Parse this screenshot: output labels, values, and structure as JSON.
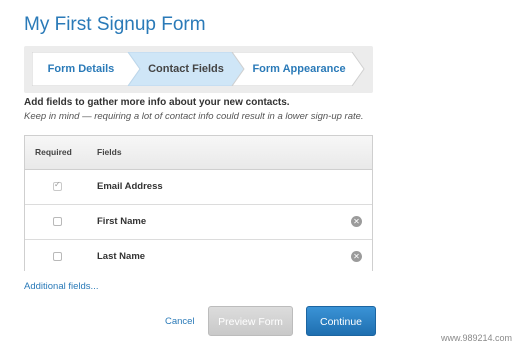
{
  "page": {
    "title": "My First Signup Form"
  },
  "steps": [
    {
      "label": "Form Details",
      "active": false
    },
    {
      "label": "Contact Fields",
      "active": true
    },
    {
      "label": "Form Appearance",
      "active": false
    }
  ],
  "intro": "Add fields to gather more info about your new contacts.",
  "note": "Keep in mind — requiring a lot of contact info could result in a lower sign-up rate.",
  "table": {
    "headers": {
      "required": "Required",
      "fields": "Fields"
    },
    "rows": [
      {
        "required": true,
        "name": "Email Address",
        "removable": false
      },
      {
        "required": false,
        "name": "First Name",
        "removable": true
      },
      {
        "required": false,
        "name": "Last Name",
        "removable": true
      }
    ]
  },
  "links": {
    "additional_fields": "Additional fields...",
    "cancel": "Cancel"
  },
  "buttons": {
    "preview": "Preview Form",
    "continue": "Continue"
  },
  "watermark": "www.989214.com",
  "colors": {
    "accent": "#2a7ab8",
    "active_step": "#cfe6f7",
    "continue_button": "#2679bf",
    "preview_button": "#d0d0d0"
  },
  "icons": {
    "remove": "remove-circle-icon",
    "check": "checkmark-icon"
  }
}
